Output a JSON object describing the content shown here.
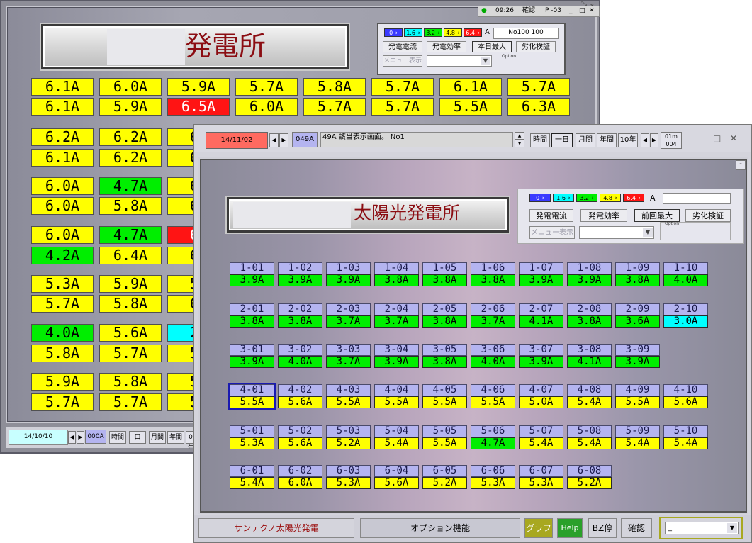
{
  "back": {
    "title": "発電所",
    "tray": {
      "time": "09:26",
      "mode": "確認",
      "page": "P -03"
    },
    "legend": {
      "items": [
        {
          "label": "0→",
          "color": "#3a3aff"
        },
        {
          "label": "1.6→",
          "color": "#00ffff"
        },
        {
          "label": "3.2→",
          "color": "#00ee00"
        },
        {
          "label": "4.8→",
          "color": "#ffff00"
        },
        {
          "label": "6.4→",
          "color": "#ff1414"
        }
      ],
      "unit": "A",
      "code": "No100 100",
      "buttons": [
        "発電電流",
        "発電効率",
        "本日最大",
        "劣化検証"
      ],
      "menu_button": "メニュー表示",
      "option_label": "Option"
    },
    "grid": [
      [
        [
          "6.1A",
          "yellow"
        ],
        [
          "6.0A",
          "yellow"
        ],
        [
          "5.9A",
          "yellow"
        ],
        [
          "5.7A",
          "yellow"
        ],
        [
          "5.8A",
          "yellow"
        ],
        [
          "5.7A",
          "yellow"
        ],
        [
          "6.1A",
          "yellow"
        ],
        [
          "5.7A",
          "yellow"
        ]
      ],
      [
        [
          "6.1A",
          "yellow"
        ],
        [
          "5.9A",
          "yellow"
        ],
        [
          "6.5A",
          "red"
        ],
        [
          "6.0A",
          "yellow"
        ],
        [
          "5.7A",
          "yellow"
        ],
        [
          "5.7A",
          "yellow"
        ],
        [
          "5.5A",
          "yellow"
        ],
        [
          "6.3A",
          "yellow"
        ]
      ],
      [
        [
          "6.2A",
          "yellow"
        ],
        [
          "6.2A",
          "yellow"
        ],
        [
          "6.",
          "yellow"
        ]
      ],
      [
        [
          "6.1A",
          "yellow"
        ],
        [
          "6.2A",
          "yellow"
        ],
        [
          "6.",
          "yellow"
        ]
      ],
      [
        [
          "6.0A",
          "yellow"
        ],
        [
          "4.7A",
          "green"
        ],
        [
          "6.",
          "yellow"
        ]
      ],
      [
        [
          "6.0A",
          "yellow"
        ],
        [
          "5.8A",
          "yellow"
        ],
        [
          "6.",
          "yellow"
        ]
      ],
      [
        [
          "6.0A",
          "yellow"
        ],
        [
          "4.7A",
          "green"
        ],
        [
          "6.",
          "red"
        ]
      ],
      [
        [
          "4.2A",
          "green"
        ],
        [
          "6.4A",
          "yellow"
        ],
        [
          "6.",
          "yellow"
        ]
      ],
      [
        [
          "5.3A",
          "yellow"
        ],
        [
          "5.9A",
          "yellow"
        ],
        [
          "5.",
          "yellow"
        ]
      ],
      [
        [
          "5.7A",
          "yellow"
        ],
        [
          "5.8A",
          "yellow"
        ],
        [
          "6.",
          "yellow"
        ]
      ],
      [
        [
          "4.0A",
          "green"
        ],
        [
          "5.6A",
          "yellow"
        ],
        [
          "2.",
          "cyan"
        ]
      ],
      [
        [
          "5.8A",
          "yellow"
        ],
        [
          "5.7A",
          "yellow"
        ],
        [
          "5.",
          "yellow"
        ]
      ],
      [
        [
          "5.9A",
          "yellow"
        ],
        [
          "5.8A",
          "yellow"
        ],
        [
          "5.",
          "yellow"
        ]
      ],
      [
        [
          "5.7A",
          "yellow"
        ],
        [
          "5.7A",
          "yellow"
        ],
        [
          "5.",
          "yellow"
        ]
      ]
    ],
    "footer": {
      "date": "14/10/10",
      "code": "000A",
      "t1": "時間",
      "t2": "口",
      "t3": "月間",
      "t4": "年間",
      "t5": "0年"
    }
  },
  "front": {
    "title": "太陽光発電所",
    "toolbar": {
      "date": "14/11/02",
      "code": "049A",
      "message": "49A 該当表示画面。 No1",
      "tabs": [
        "時間",
        "一日",
        "月間",
        "年間",
        "10年"
      ],
      "counter_top": "01m",
      "counter_bottom": "004"
    },
    "legend": {
      "items": [
        {
          "label": "0→",
          "color": "#3a3aff"
        },
        {
          "label": "1.6→",
          "color": "#00ffff"
        },
        {
          "label": "3.2→",
          "color": "#00ee00"
        },
        {
          "label": "4.8→",
          "color": "#ffff00"
        },
        {
          "label": "6.4→",
          "color": "#ff1414"
        }
      ],
      "unit": "A",
      "buttons": [
        "発電電流",
        "発電効率",
        "前回最大",
        "劣化検証"
      ],
      "menu_button": "メニュー表示",
      "option_label": "Option"
    },
    "grid": [
      [
        [
          "1-01",
          "3.9A",
          "green"
        ],
        [
          "1-02",
          "3.9A",
          "green"
        ],
        [
          "1-03",
          "3.9A",
          "green"
        ],
        [
          "1-04",
          "3.8A",
          "green"
        ],
        [
          "1-05",
          "3.8A",
          "green"
        ],
        [
          "1-06",
          "3.8A",
          "green"
        ],
        [
          "1-07",
          "3.9A",
          "green"
        ],
        [
          "1-08",
          "3.9A",
          "green"
        ],
        [
          "1-09",
          "3.8A",
          "green"
        ],
        [
          "1-10",
          "4.0A",
          "green"
        ]
      ],
      [
        [
          "2-01",
          "3.8A",
          "green"
        ],
        [
          "2-02",
          "3.8A",
          "green"
        ],
        [
          "2-03",
          "3.7A",
          "green"
        ],
        [
          "2-04",
          "3.7A",
          "green"
        ],
        [
          "2-05",
          "3.8A",
          "green"
        ],
        [
          "2-06",
          "3.7A",
          "green"
        ],
        [
          "2-07",
          "4.1A",
          "green"
        ],
        [
          "2-08",
          "3.8A",
          "green"
        ],
        [
          "2-09",
          "3.6A",
          "green"
        ],
        [
          "2-10",
          "3.0A",
          "cyan"
        ]
      ],
      [
        [
          "3-01",
          "3.9A",
          "green"
        ],
        [
          "3-02",
          "4.0A",
          "green"
        ],
        [
          "3-03",
          "3.7A",
          "green"
        ],
        [
          "3-04",
          "3.9A",
          "green"
        ],
        [
          "3-05",
          "3.8A",
          "green"
        ],
        [
          "3-06",
          "4.0A",
          "green"
        ],
        [
          "3-07",
          "3.9A",
          "green"
        ],
        [
          "3-08",
          "4.1A",
          "green"
        ],
        [
          "3-09",
          "3.9A",
          "green"
        ]
      ],
      [
        [
          "4-01",
          "5.5A",
          "yellow"
        ],
        [
          "4-02",
          "5.6A",
          "yellow"
        ],
        [
          "4-03",
          "5.5A",
          "yellow"
        ],
        [
          "4-04",
          "5.5A",
          "yellow"
        ],
        [
          "4-05",
          "5.5A",
          "yellow"
        ],
        [
          "4-06",
          "5.5A",
          "yellow"
        ],
        [
          "4-07",
          "5.0A",
          "yellow"
        ],
        [
          "4-08",
          "5.4A",
          "yellow"
        ],
        [
          "4-09",
          "5.5A",
          "yellow"
        ],
        [
          "4-10",
          "5.6A",
          "yellow"
        ]
      ],
      [
        [
          "5-01",
          "5.3A",
          "yellow"
        ],
        [
          "5-02",
          "5.6A",
          "yellow"
        ],
        [
          "5-03",
          "5.2A",
          "yellow"
        ],
        [
          "5-04",
          "5.4A",
          "yellow"
        ],
        [
          "5-05",
          "5.5A",
          "yellow"
        ],
        [
          "5-06",
          "4.7A",
          "green"
        ],
        [
          "5-07",
          "5.4A",
          "yellow"
        ],
        [
          "5-08",
          "5.4A",
          "yellow"
        ],
        [
          "5-09",
          "5.4A",
          "yellow"
        ],
        [
          "5-10",
          "5.4A",
          "yellow"
        ]
      ],
      [
        [
          "6-01",
          "5.4A",
          "yellow"
        ],
        [
          "6-02",
          "6.0A",
          "yellow"
        ],
        [
          "6-03",
          "5.3A",
          "yellow"
        ],
        [
          "6-04",
          "5.6A",
          "yellow"
        ],
        [
          "6-05",
          "5.2A",
          "yellow"
        ],
        [
          "6-06",
          "5.3A",
          "yellow"
        ],
        [
          "6-07",
          "5.3A",
          "yellow"
        ],
        [
          "6-08",
          "5.2A",
          "yellow"
        ]
      ]
    ],
    "bottom": {
      "brand": "サンテクノ太陽光発電",
      "option": "オプション機能",
      "graph": "グラフ",
      "help": "Help",
      "bz": "BZ停",
      "confirm": "確認",
      "select_value": "_"
    }
  }
}
